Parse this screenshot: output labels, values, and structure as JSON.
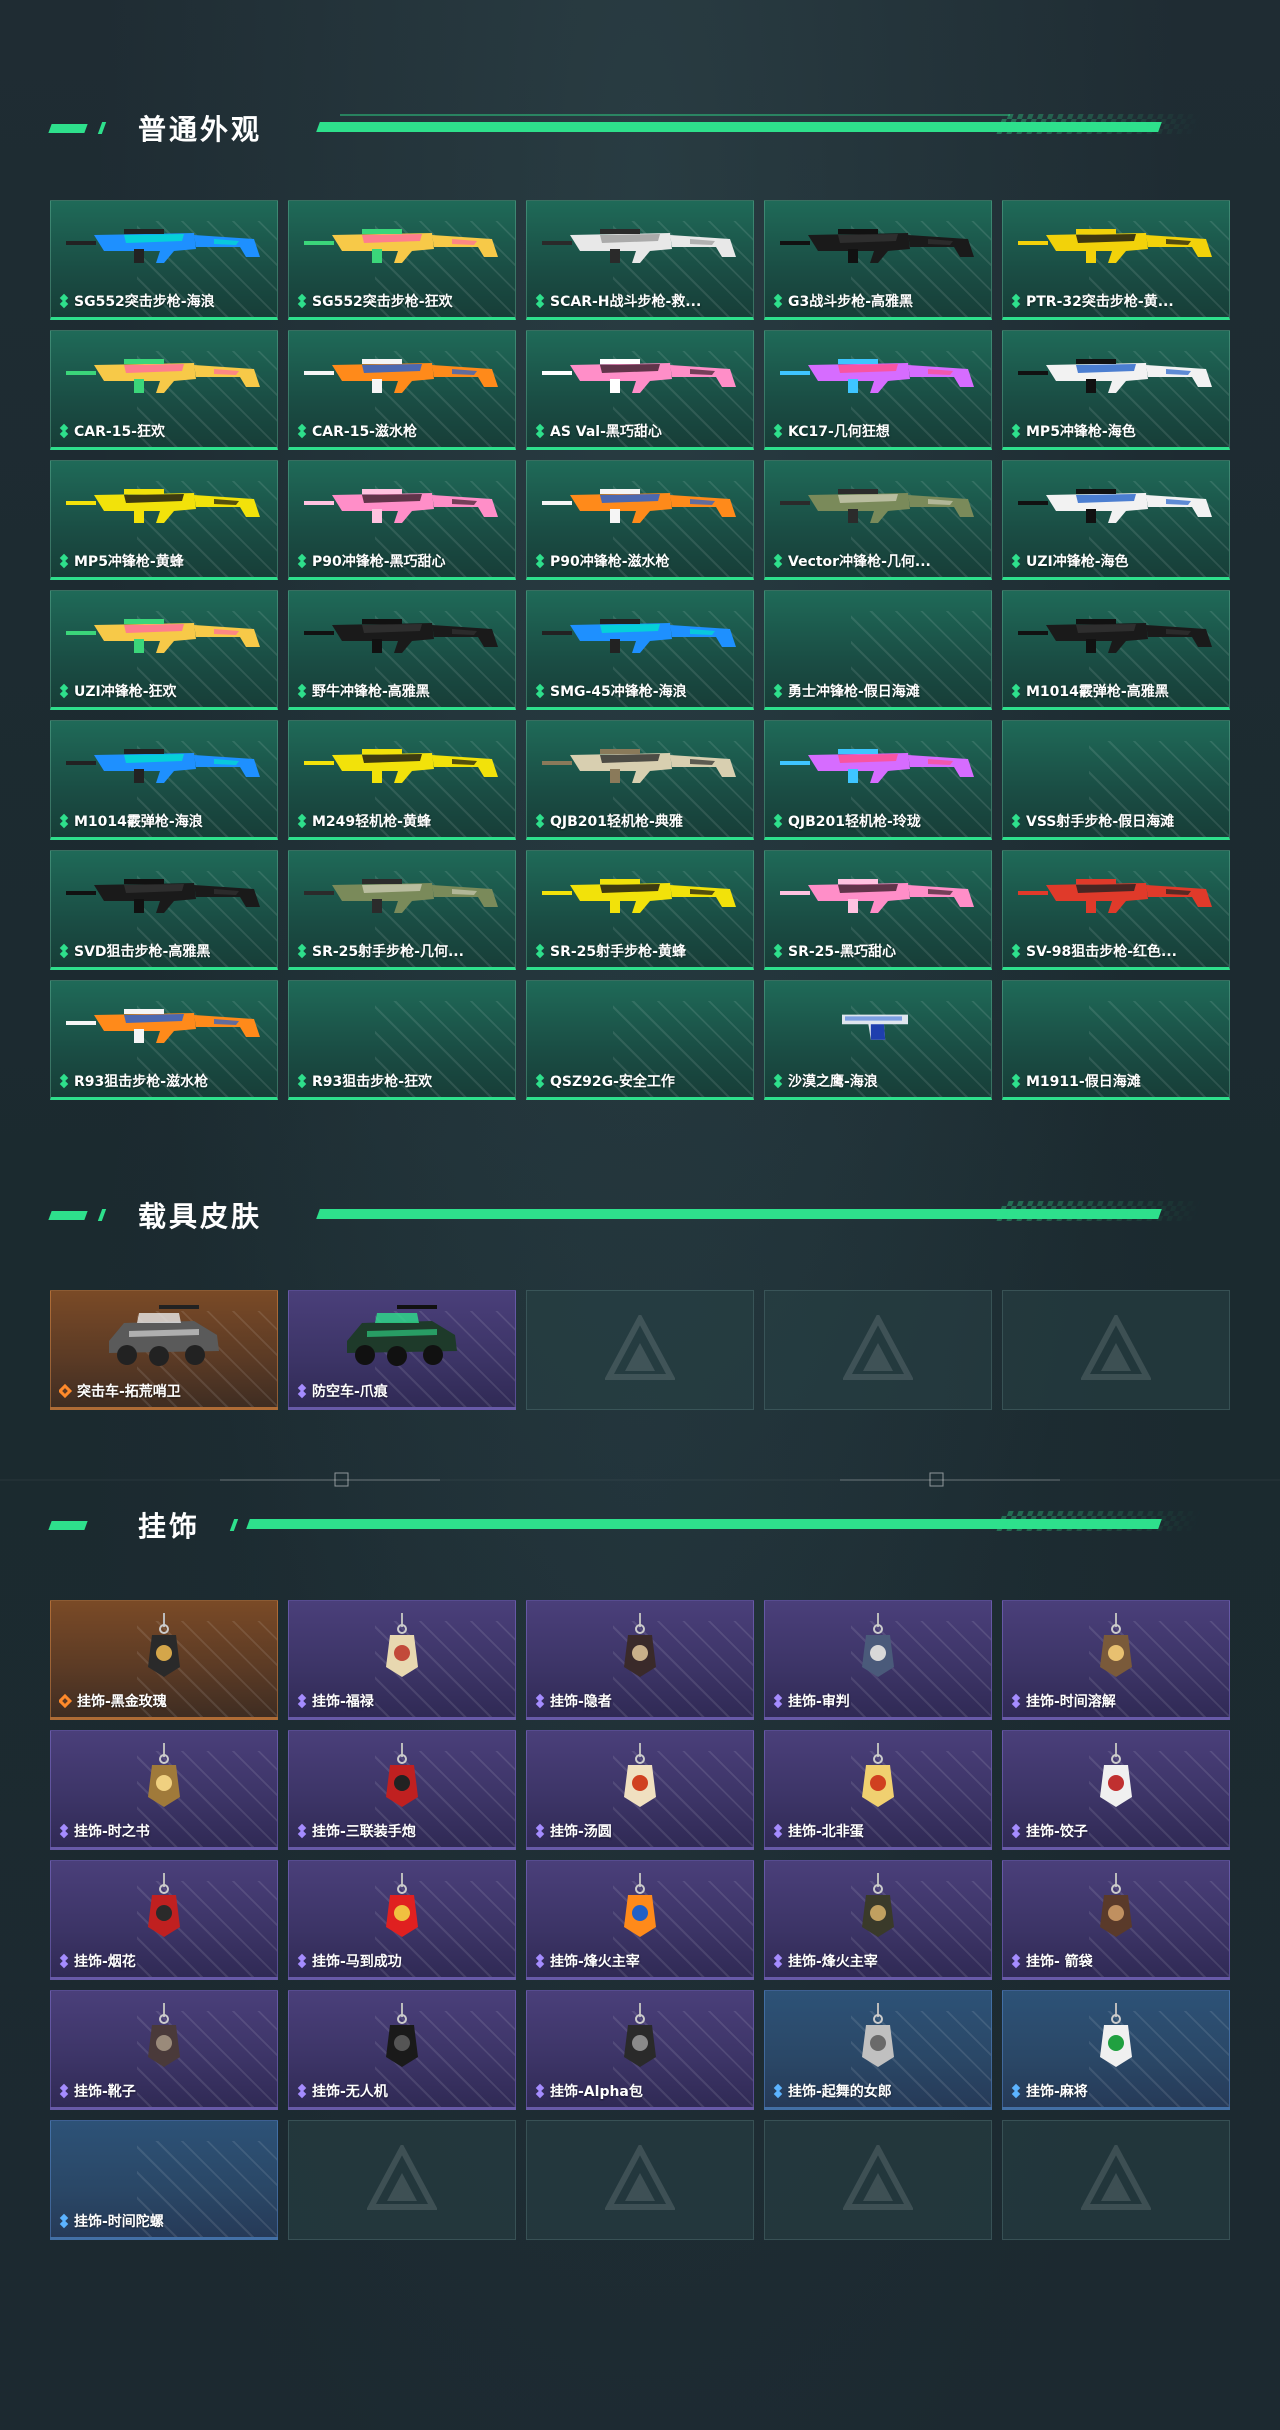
{
  "sections": [
    {
      "title": "普通外观",
      "items": [
        {
          "label": "SG552突击步枪-海浪",
          "rarity": "green",
          "art": "gun",
          "colors": [
            "#1e90ff",
            "#00e0d0",
            "#222"
          ]
        },
        {
          "label": "SG552突击步枪-狂欢",
          "rarity": "green",
          "art": "gun",
          "colors": [
            "#f7c948",
            "#ff6b9d",
            "#3bd67a"
          ]
        },
        {
          "label": "SCAR-H战斗步枪-救...",
          "rarity": "green",
          "art": "gun",
          "colors": [
            "#e8e8e8",
            "#9a9a9a",
            "#2a2a2a"
          ]
        },
        {
          "label": "G3战斗步枪-高雅黑",
          "rarity": "green",
          "art": "gun",
          "colors": [
            "#1a1a1a",
            "#333",
            "#111"
          ]
        },
        {
          "label": "PTR-32突击步枪-黄...",
          "rarity": "green",
          "art": "gun",
          "colors": [
            "#f2d20a",
            "#111",
            "#f2d20a"
          ]
        },
        {
          "label": "CAR-15-狂欢",
          "rarity": "green",
          "art": "gun",
          "colors": [
            "#f7c948",
            "#ff6b9d",
            "#3bd67a"
          ]
        },
        {
          "label": "CAR-15-滋水枪",
          "rarity": "green",
          "art": "gun",
          "colors": [
            "#ff8a1a",
            "#1f5fd6",
            "#f5f5f5"
          ]
        },
        {
          "label": "AS Val-黑巧甜心",
          "rarity": "green",
          "art": "gun",
          "colors": [
            "#ff8ec8",
            "#3a1e2a",
            "#fff"
          ]
        },
        {
          "label": "KC17-几何狂想",
          "rarity": "green",
          "art": "gun",
          "colors": [
            "#d66cff",
            "#ff4f8a",
            "#3ec5ff"
          ]
        },
        {
          "label": "MP5冲锋枪-海色",
          "rarity": "green",
          "art": "gun",
          "colors": [
            "#f2f2f2",
            "#2060c8",
            "#111"
          ]
        },
        {
          "label": "MP5冲锋枪-黄蜂",
          "rarity": "green",
          "art": "gun",
          "colors": [
            "#f2e20a",
            "#111",
            "#f2e20a"
          ]
        },
        {
          "label": "P90冲锋枪-黑巧甜心",
          "rarity": "green",
          "art": "gun",
          "colors": [
            "#ff8ec8",
            "#3a1e2a",
            "#ffc2e0"
          ]
        },
        {
          "label": "P90冲锋枪-滋水枪",
          "rarity": "green",
          "art": "gun",
          "colors": [
            "#ff8a1a",
            "#1f5fd6",
            "#f5f5f5"
          ]
        },
        {
          "label": "Vector冲锋枪-几何...",
          "rarity": "green",
          "art": "gun",
          "colors": [
            "#7a8a5a",
            "#c9c9b0",
            "#2b2b2b"
          ]
        },
        {
          "label": "UZI冲锋枪-海色",
          "rarity": "green",
          "art": "gun",
          "colors": [
            "#f2f2f2",
            "#2060c8",
            "#111"
          ]
        },
        {
          "label": "UZI冲锋枪-狂欢",
          "rarity": "green",
          "art": "gun",
          "colors": [
            "#f7c948",
            "#ff6b9d",
            "#3bd67a"
          ]
        },
        {
          "label": "野牛冲锋枪-高雅黑",
          "rarity": "green",
          "art": "gun",
          "colors": [
            "#1a1a1a",
            "#333",
            "#111"
          ]
        },
        {
          "label": "SMG-45冲锋枪-海浪",
          "rarity": "green",
          "art": "gun",
          "colors": [
            "#1e90ff",
            "#00e0d0",
            "#222"
          ]
        },
        {
          "label": "勇士冲锋枪-假日海滩",
          "rarity": "green",
          "art": "none",
          "colors": []
        },
        {
          "label": "M1014霰弹枪-高雅黑",
          "rarity": "green",
          "art": "gun",
          "colors": [
            "#1a1a1a",
            "#333",
            "#111"
          ]
        },
        {
          "label": "M1014霰弹枪-海浪",
          "rarity": "green",
          "art": "gun",
          "colors": [
            "#1e90ff",
            "#00e0d0",
            "#222"
          ]
        },
        {
          "label": "M249轻机枪-黄蜂",
          "rarity": "green",
          "art": "gun",
          "colors": [
            "#f2e20a",
            "#111",
            "#f2e20a"
          ]
        },
        {
          "label": "QJB201轻机枪-典雅",
          "rarity": "green",
          "art": "gun",
          "colors": [
            "#d8cfb0",
            "#2a2a2a",
            "#8a7a5a"
          ]
        },
        {
          "label": "QJB201轻机枪-玲珑",
          "rarity": "green",
          "art": "gun",
          "colors": [
            "#d66cff",
            "#ff4f8a",
            "#3ec5ff"
          ]
        },
        {
          "label": "VSS射手步枪-假日海滩",
          "rarity": "green",
          "art": "none",
          "colors": []
        },
        {
          "label": "SVD狙击步枪-高雅黑",
          "rarity": "green",
          "art": "gun",
          "colors": [
            "#1a1a1a",
            "#333",
            "#111"
          ]
        },
        {
          "label": "SR-25射手步枪-几何...",
          "rarity": "green",
          "art": "gun",
          "colors": [
            "#7a8a5a",
            "#c9c9b0",
            "#2b2b2b"
          ]
        },
        {
          "label": "SR-25射手步枪-黄蜂",
          "rarity": "green",
          "art": "gun",
          "colors": [
            "#f2e20a",
            "#111",
            "#f2e20a"
          ]
        },
        {
          "label": "SR-25-黑巧甜心",
          "rarity": "green",
          "art": "gun",
          "colors": [
            "#ff8ec8",
            "#3a1e2a",
            "#ffc2e0"
          ]
        },
        {
          "label": "SV-98狙击步枪-红色...",
          "rarity": "green",
          "art": "gun",
          "colors": [
            "#e03a2a",
            "#222",
            "#e03a2a"
          ]
        },
        {
          "label": "R93狙击步枪-滋水枪",
          "rarity": "green",
          "art": "gun",
          "colors": [
            "#ff8a1a",
            "#1f5fd6",
            "#f5f5f5"
          ]
        },
        {
          "label": "R93狙击步枪-狂欢",
          "rarity": "green",
          "art": "none",
          "colors": []
        },
        {
          "label": "QSZ92G-安全工作",
          "rarity": "green",
          "art": "none",
          "colors": []
        },
        {
          "label": "沙漠之鹰-海浪",
          "rarity": "green",
          "art": "pistol",
          "colors": [
            "#1e3fae",
            "#dfe6ee",
            "#3a6fd8"
          ]
        },
        {
          "label": "M1911-假日海滩",
          "rarity": "green",
          "art": "none",
          "colors": []
        }
      ]
    },
    {
      "title": "载具皮肤",
      "items": [
        {
          "label": "突击车-拓荒哨卫",
          "rarity": "orange",
          "art": "vehicle",
          "colors": [
            "#5a5a5a",
            "#e8e8e8",
            "#222"
          ]
        },
        {
          "label": "防空车-爪痕",
          "rarity": "purple",
          "art": "vehicle",
          "colors": [
            "#1e3a2a",
            "#2ee08c",
            "#111"
          ]
        },
        {
          "label": "",
          "rarity": "empty",
          "art": "none",
          "colors": []
        },
        {
          "label": "",
          "rarity": "empty",
          "art": "none",
          "colors": []
        },
        {
          "label": "",
          "rarity": "empty",
          "art": "none",
          "colors": []
        }
      ]
    },
    {
      "title": "挂饰",
      "items": [
        {
          "label": "挂饰-黑金玫瑰",
          "rarity": "orange",
          "art": "charm",
          "colors": [
            "#2a2a2a",
            "#d4a64a"
          ]
        },
        {
          "label": "挂饰-福禄",
          "rarity": "purple",
          "art": "charm",
          "colors": [
            "#e8d8b0",
            "#c24a3a"
          ]
        },
        {
          "label": "挂饰-隐者",
          "rarity": "purple",
          "art": "charm",
          "colors": [
            "#3a2a2a",
            "#c9b08a"
          ]
        },
        {
          "label": "挂饰-审判",
          "rarity": "purple",
          "art": "charm",
          "colors": [
            "#4a5a7a",
            "#d8d8d8"
          ]
        },
        {
          "label": "挂饰-时间溶解",
          "rarity": "purple",
          "art": "charm",
          "colors": [
            "#7a5a3a",
            "#e8c070"
          ]
        },
        {
          "label": "挂饰-时之书",
          "rarity": "purple",
          "art": "charm",
          "colors": [
            "#a07a3a",
            "#f0d080"
          ]
        },
        {
          "label": "挂饰-三联装手炮",
          "rarity": "purple",
          "art": "charm",
          "colors": [
            "#c02020",
            "#222"
          ]
        },
        {
          "label": "挂饰-汤圆",
          "rarity": "purple",
          "art": "charm",
          "colors": [
            "#f0e0c0",
            "#d04020"
          ]
        },
        {
          "label": "挂饰-北非蛋",
          "rarity": "purple",
          "art": "charm",
          "colors": [
            "#f0d070",
            "#d04020"
          ]
        },
        {
          "label": "挂饰-饺子",
          "rarity": "purple",
          "art": "charm",
          "colors": [
            "#f0f0f0",
            "#c03030"
          ]
        },
        {
          "label": "挂饰-烟花",
          "rarity": "purple",
          "art": "charm",
          "colors": [
            "#c02020",
            "#2a2a2a"
          ]
        },
        {
          "label": "挂饰-马到成功",
          "rarity": "purple",
          "art": "charm",
          "colors": [
            "#e02020",
            "#f0c040"
          ]
        },
        {
          "label": "挂饰-烽火主宰",
          "rarity": "purple",
          "art": "charm",
          "colors": [
            "#ff8a1a",
            "#2060c8"
          ]
        },
        {
          "label": "挂饰-烽火主宰",
          "rarity": "purple",
          "art": "charm",
          "colors": [
            "#3a3a2a",
            "#c0a060"
          ]
        },
        {
          "label": "挂饰- 箭袋",
          "rarity": "purple",
          "art": "charm",
          "colors": [
            "#5a3a2a",
            "#c09060"
          ]
        },
        {
          "label": "挂饰-靴子",
          "rarity": "purple",
          "art": "charm",
          "colors": [
            "#4a3a3a",
            "#9a8a7a"
          ]
        },
        {
          "label": "挂饰-无人机",
          "rarity": "purple",
          "art": "charm",
          "colors": [
            "#1a1a1a",
            "#555"
          ]
        },
        {
          "label": "挂饰-Alpha包",
          "rarity": "purple",
          "art": "charm",
          "colors": [
            "#2a2a2a",
            "#8a8a8a"
          ]
        },
        {
          "label": "挂饰-起舞的女郎",
          "rarity": "blue",
          "art": "charm",
          "colors": [
            "#c0c0c0",
            "#6a6a6a"
          ]
        },
        {
          "label": "挂饰-麻将",
          "rarity": "blue",
          "art": "charm",
          "colors": [
            "#f0f0f0",
            "#20a040"
          ]
        },
        {
          "label": "挂饰-时间陀螺",
          "rarity": "blue",
          "art": "none",
          "colors": []
        },
        {
          "label": "",
          "rarity": "empty",
          "art": "none",
          "colors": []
        },
        {
          "label": "",
          "rarity": "empty",
          "art": "none",
          "colors": []
        },
        {
          "label": "",
          "rarity": "empty",
          "art": "none",
          "colors": []
        },
        {
          "label": "",
          "rarity": "empty",
          "art": "none",
          "colors": []
        }
      ]
    }
  ]
}
